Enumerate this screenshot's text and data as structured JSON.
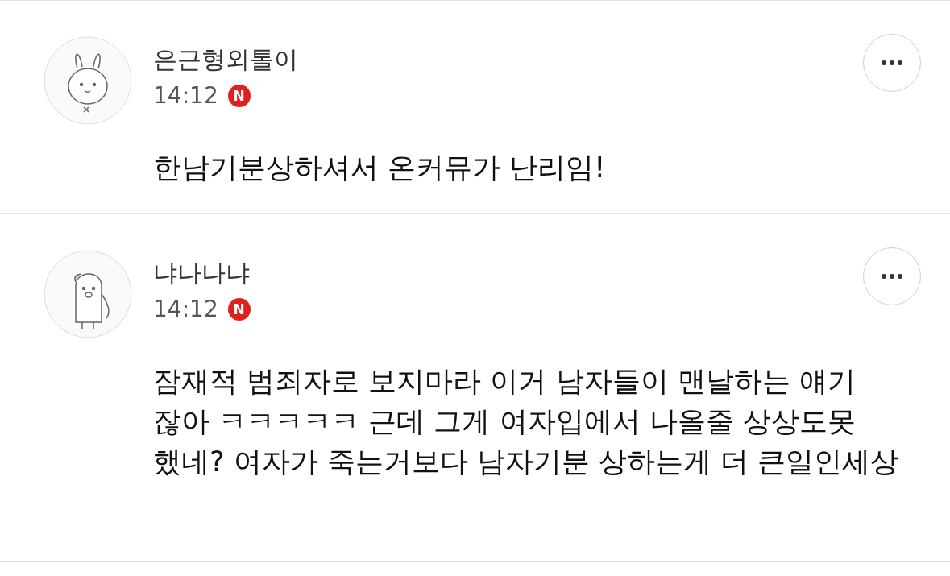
{
  "comments": [
    {
      "author": "은근형외톨이",
      "time": "14:12",
      "badge": "N",
      "text": "한남기분상하셔서 온커뮤가 난리임!",
      "avatar": {
        "kind": "rabbit"
      }
    },
    {
      "author": "냐나나냐",
      "time": "14:12",
      "badge": "N",
      "text": "잠재적 범죄자로 보지마라 이거 남자들이 맨날하는 얘기 잖아 ㅋㅋㅋㅋㅋ 근데 그게 여자입에서 나올줄 상상도못 했네? 여자가 죽는거보다 남자기분 상하는게 더 큰일인세상",
      "avatar": {
        "kind": "penguin"
      }
    }
  ]
}
